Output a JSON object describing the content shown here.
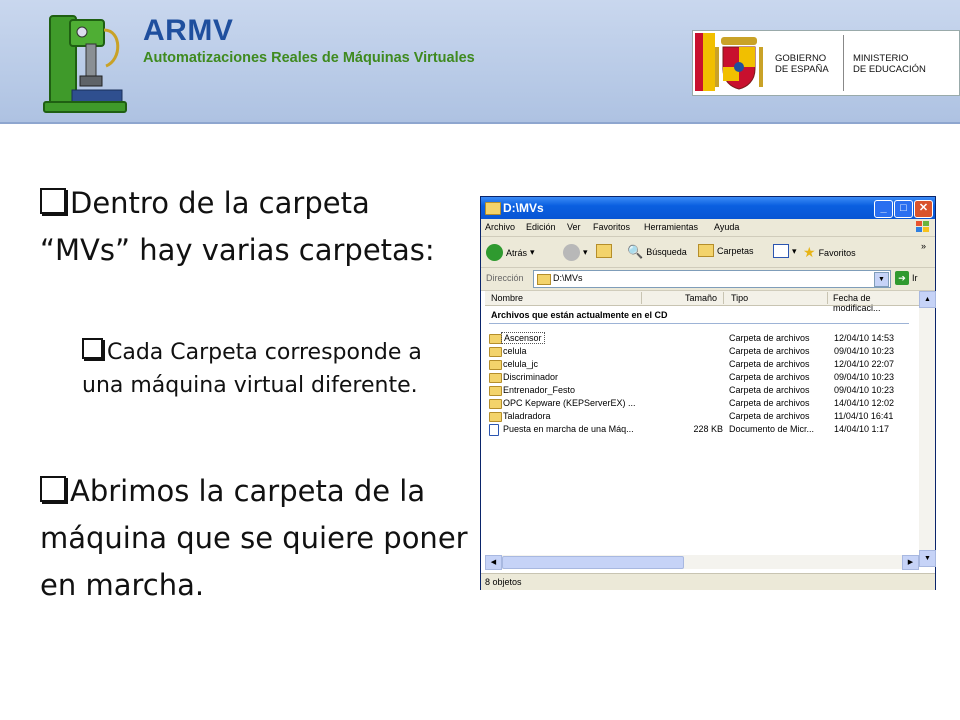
{
  "header": {
    "title": "ARMV",
    "subtitle": "Automatizaciones Reales de Máquinas Virtuales",
    "gov_line1": "GOBIERNO",
    "gov_line2": "DE ESPAÑA",
    "ministry_line1": "MINISTERIO",
    "ministry_line2": "DE EDUCACIÓN"
  },
  "bullets": [
    {
      "text": "Dentro de la carpeta “MVs” hay varias carpetas:"
    },
    {
      "text": "Cada Carpeta corresponde a una máquina virtual diferente."
    },
    {
      "text": "Abrimos la carpeta de la máquina que se quiere poner en marcha."
    }
  ],
  "explorer": {
    "title": "D:\\MVs",
    "menu": [
      "Archivo",
      "Edición",
      "Ver",
      "Favoritos",
      "Herramientas",
      "Ayuda"
    ],
    "toolbar": {
      "back": "Atrás",
      "search": "Búsqueda",
      "folders": "Carpetas",
      "favorites": "Favoritos",
      "overflow": "»"
    },
    "address_label": "Dirección",
    "address_value": "D:\\MVs",
    "go_label": "Ir",
    "columns": [
      "Nombre",
      "Tamaño",
      "Tipo",
      "Fecha de modificaci..."
    ],
    "group_header": "Archivos que están actualmente en el CD",
    "files": [
      {
        "name": "Ascensor",
        "size": "",
        "type": "Carpeta de archivos",
        "date": "12/04/10 14:53"
      },
      {
        "name": "celula",
        "size": "",
        "type": "Carpeta de archivos",
        "date": "09/04/10 10:23"
      },
      {
        "name": "celula_jc",
        "size": "",
        "type": "Carpeta de archivos",
        "date": "12/04/10 22:07"
      },
      {
        "name": "Discriminador",
        "size": "",
        "type": "Carpeta de archivos",
        "date": "09/04/10 10:23"
      },
      {
        "name": "Entrenador_Festo",
        "size": "",
        "type": "Carpeta de archivos",
        "date": "09/04/10 10:23"
      },
      {
        "name": "OPC Kepware (KEPServerEX) ...",
        "size": "",
        "type": "Carpeta de archivos",
        "date": "14/04/10 12:02"
      },
      {
        "name": "Taladradora",
        "size": "",
        "type": "Carpeta de archivos",
        "date": "11/04/10 16:41"
      },
      {
        "name": "Puesta en marcha de una Máq...",
        "size": "228 KB",
        "type": "Documento de Micr...",
        "date": "14/04/10 1:17"
      }
    ],
    "status": "8 objetos"
  }
}
